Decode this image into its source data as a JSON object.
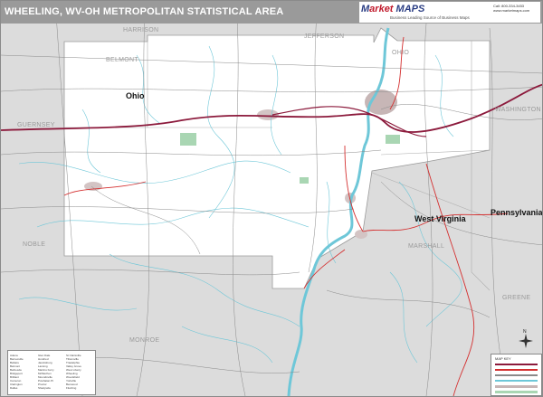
{
  "map": {
    "title": "WHEELING, WV-OH METROPOLITAN STATISTICAL AREA",
    "brand": {
      "name_part1": "arket",
      "name_part2": "MAPS",
      "tagline": "Business Leading Source of Business Maps",
      "info_lines": [
        "Call: 800-334-3453",
        "www.marketmaps.com"
      ]
    },
    "state_labels": {
      "ohio": "Ohio",
      "west_virginia": "West Virginia",
      "pennsylvania": "Pennsylvania"
    },
    "county_labels": {
      "harrison": "HARRISON",
      "jefferson": "JEFFERSON",
      "belmont": "BELMONT",
      "ohio_county": "OHIO",
      "guernsey": "GUERNSEY",
      "washington": "WASHINGTON",
      "noble": "NOBLE",
      "marshall": "MARSHALL",
      "greene": "GREENE",
      "monroe": "MONROE"
    },
    "colors": {
      "water": "#6ec7d8",
      "interstate": "#8c1a3c",
      "us_highway": "#d43030",
      "road": "#7a7a7a",
      "outside_area": "#dcdcdc",
      "msa_area": "#ffffff",
      "urban": "#c7b6b6",
      "park": "#a9d6b3"
    },
    "legend": {
      "index_columns": [
        [
          "Adena",
          "Barnesville",
          "Bellaire",
          "Belmont",
          "Bethesda",
          "Bridgeport",
          "Brilliant",
          "Cameron",
          "Clarington",
          "Dallas"
        ],
        [
          "Glen Dale",
          "Hundred",
          "Jacobsburg",
          "Lansing",
          "Martins Ferry",
          "McMechen",
          "Moundsville",
          "Powhatan Pt",
          "Proctor",
          "Shadyside"
        ],
        [
          "St Clairsville",
          "Tiltonsville",
          "Triadelphia",
          "Valley Grove",
          "West Liberty",
          "Wheeling",
          "Woodsfield",
          "Yorkville",
          "Benwood",
          "Flushing"
        ]
      ],
      "key_title": "MAP KEY"
    },
    "compass_label": "N"
  }
}
